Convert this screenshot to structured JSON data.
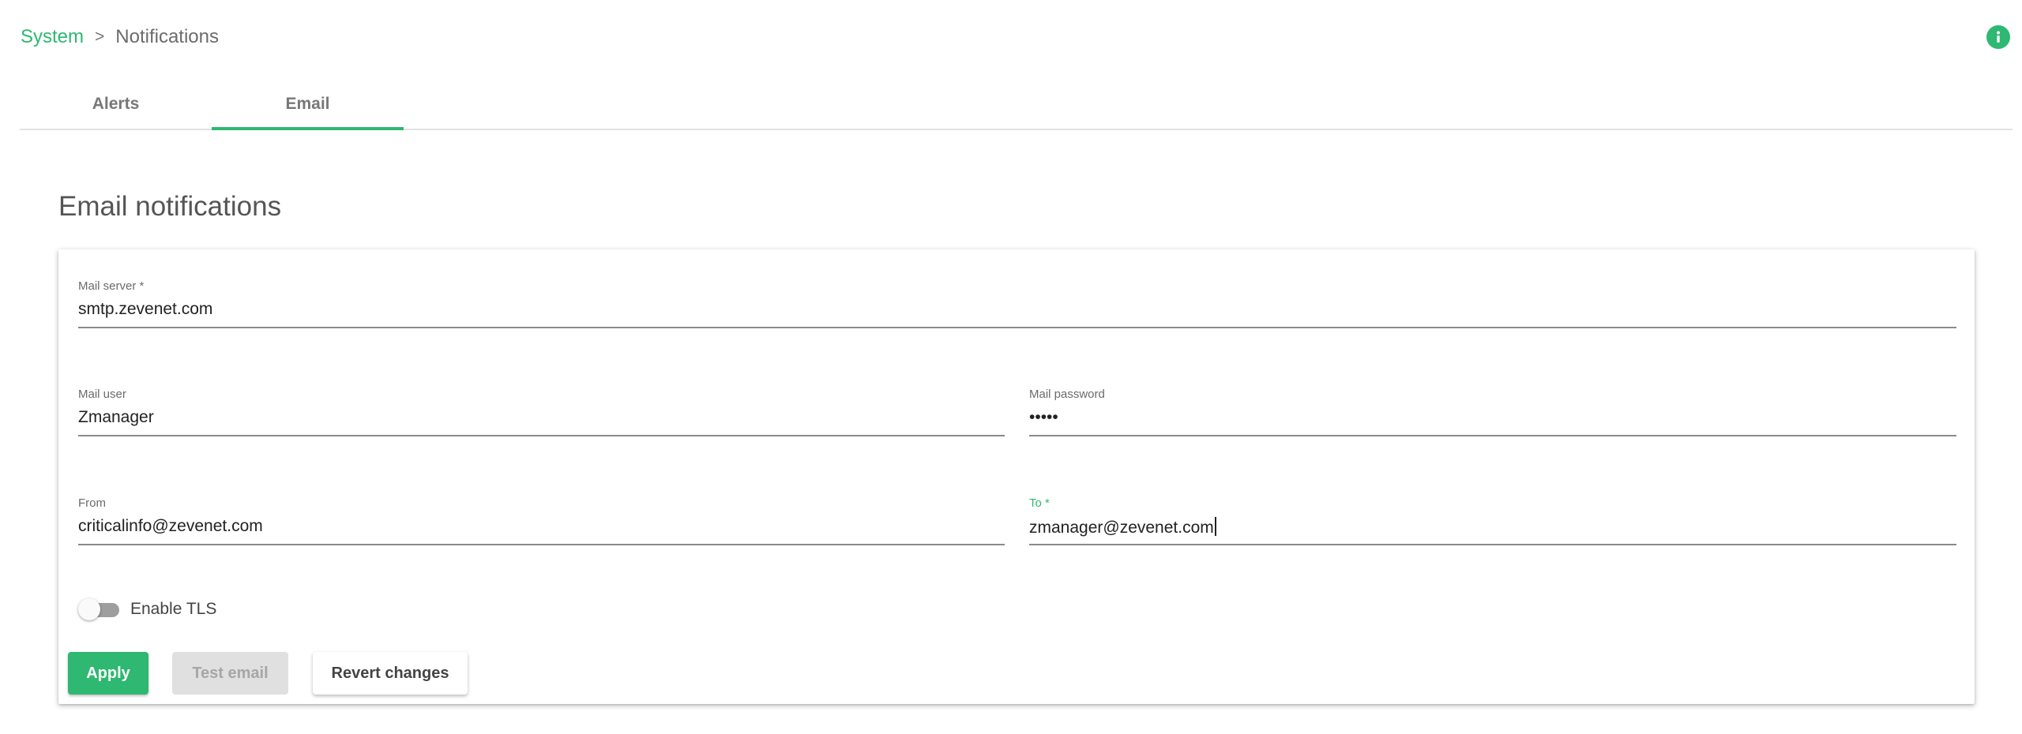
{
  "breadcrumb": {
    "parent": "System",
    "separator": ">",
    "current": "Notifications"
  },
  "header": {
    "info_icon": "info-icon"
  },
  "tabs": [
    {
      "label": "Alerts",
      "active": false
    },
    {
      "label": "Email",
      "active": true
    }
  ],
  "section": {
    "title": "Email notifications"
  },
  "form": {
    "mail_server": {
      "label": "Mail server *",
      "value": "smtp.zevenet.com"
    },
    "mail_user": {
      "label": "Mail user",
      "value": "Zmanager"
    },
    "mail_password": {
      "label": "Mail password",
      "value": "•••••"
    },
    "from": {
      "label": "From",
      "value": "criticalinfo@zevenet.com"
    },
    "to": {
      "label": "To *",
      "value": "zmanager@zevenet.com"
    },
    "enable_tls": {
      "label": "Enable TLS",
      "checked": false
    }
  },
  "buttons": {
    "apply": "Apply",
    "test_email": "Test email",
    "revert_changes": "Revert changes"
  },
  "colors": {
    "accent": "#2eb872",
    "disabled_bg": "#e0e0e0",
    "disabled_text": "#a6a6a6"
  }
}
